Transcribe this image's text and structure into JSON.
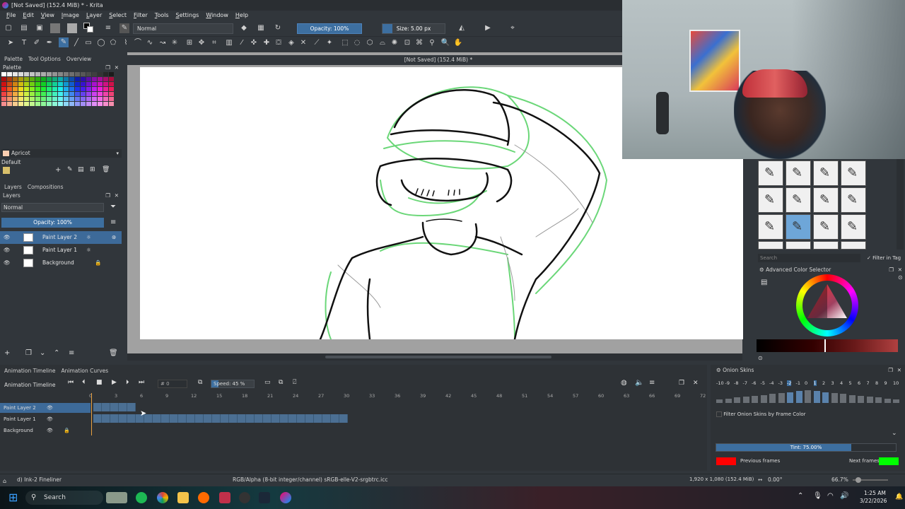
{
  "window": {
    "title": "[Not Saved]  (152.4 MiB) * - Krita",
    "canvas_title": "[Not Saved]  (152.4 MiB) *"
  },
  "menu": [
    "File",
    "Edit",
    "View",
    "Image",
    "Layer",
    "Select",
    "Filter",
    "Tools",
    "Settings",
    "Window",
    "Help"
  ],
  "toolbar": {
    "blend_mode": "Normal",
    "opacity": "Opacity: 100%",
    "size": "Size: 5.00 px"
  },
  "left_docker": {
    "tabs": [
      "Palette",
      "Tool Options",
      "Overview"
    ],
    "palette_title": "Palette",
    "color_name": "Apricot",
    "palette_name": "Default"
  },
  "layers_panel": {
    "tabs": [
      "Layers",
      "Compositions"
    ],
    "title": "Layers",
    "blend_mode": "Normal",
    "opacity": "Opacity:  100%",
    "layers": [
      {
        "name": "Paint Layer 2",
        "selected": true
      },
      {
        "name": "Paint Layer 1",
        "selected": false
      },
      {
        "name": "Background",
        "selected": false
      }
    ]
  },
  "brushes": {
    "search_placeholder": "Search",
    "filter_in_tag": "Filter in Tag"
  },
  "color_selector": {
    "title": "Advanced Color Selector"
  },
  "timeline": {
    "tabs": [
      "Animation Timeline",
      "Animation Curves"
    ],
    "title": "Animation Timeline",
    "frame_field": "0",
    "speed": "Speed: 45 %",
    "ruler": [
      "0",
      "3",
      "6",
      "9",
      "12",
      "15",
      "18",
      "21",
      "24",
      "27",
      "30",
      "33",
      "36",
      "39",
      "42",
      "45",
      "48",
      "51",
      "54",
      "57",
      "60",
      "63",
      "66",
      "69",
      "72"
    ],
    "layers": [
      "Paint Layer 2",
      "Paint Layer 1",
      "Background"
    ]
  },
  "onion": {
    "title": "Onion Skins",
    "numbers": [
      "-10",
      "-9",
      "-8",
      "-7",
      "-6",
      "-5",
      "-4",
      "-3",
      "-2",
      "-1",
      "0",
      "1",
      "2",
      "3",
      "4",
      "5",
      "6",
      "7",
      "8",
      "9",
      "10"
    ],
    "filter_label": "Filter Onion Skins by Frame Color",
    "tint": "Tint: 75.00%",
    "tint_value": 0.75,
    "previous_label": "Previous frames",
    "next_label": "Next frames",
    "previous_color": "#ff0000",
    "next_color": "#00ff00"
  },
  "status": {
    "brush": "d) Ink-2 Fineliner",
    "color_profile": "RGB/Alpha (8-bit integer/channel)  sRGB-elle-V2-srgbtrc.icc",
    "dimensions": "1,920 x 1,080 (152.4 MiB)",
    "rotation": "0.00°",
    "zoom": "66.7%"
  },
  "taskbar": {
    "search": "Search",
    "time": "1:25 AM",
    "date": "3/22/2026"
  },
  "colors": {
    "accent": "#3d6a99",
    "selection": "#3d6fa0"
  }
}
